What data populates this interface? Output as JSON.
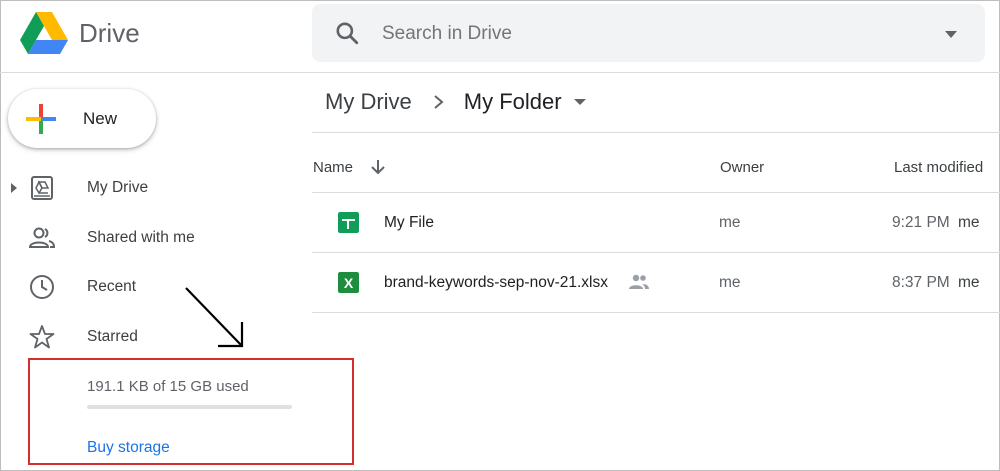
{
  "app": {
    "brand": "Drive",
    "logo_icon": "google-drive-logo"
  },
  "search": {
    "placeholder": "Search in Drive",
    "icon": "search-icon"
  },
  "sidebar": {
    "new_label": "New",
    "items": [
      {
        "label": "My Drive",
        "icon": "my-drive-icon",
        "expandable": true
      },
      {
        "label": "Shared with me",
        "icon": "people-icon"
      },
      {
        "label": "Recent",
        "icon": "clock-icon"
      },
      {
        "label": "Starred",
        "icon": "star-icon"
      }
    ],
    "storage": {
      "text": "191.1 KB of 15 GB used",
      "used_fraction": 1e-05,
      "buy_label": "Buy storage"
    }
  },
  "breadcrumb": {
    "root": "My Drive",
    "current": "My Folder"
  },
  "table": {
    "headers": {
      "name": "Name",
      "owner": "Owner",
      "modified": "Last modified"
    },
    "rows": [
      {
        "name": "My File",
        "type": "google-sheets",
        "owner": "me",
        "time": "9:21 PM",
        "modified_by": "me",
        "shared": false
      },
      {
        "name": "brand-keywords-sep-nov-21.xlsx",
        "type": "excel",
        "owner": "me",
        "time": "8:37 PM",
        "modified_by": "me",
        "shared": true
      }
    ]
  },
  "colors": {
    "accent": "#1a73e8",
    "sheets_green": "#0f9d58",
    "excel_green": "#1e8e3e",
    "highlight_red": "#d32f2f"
  }
}
